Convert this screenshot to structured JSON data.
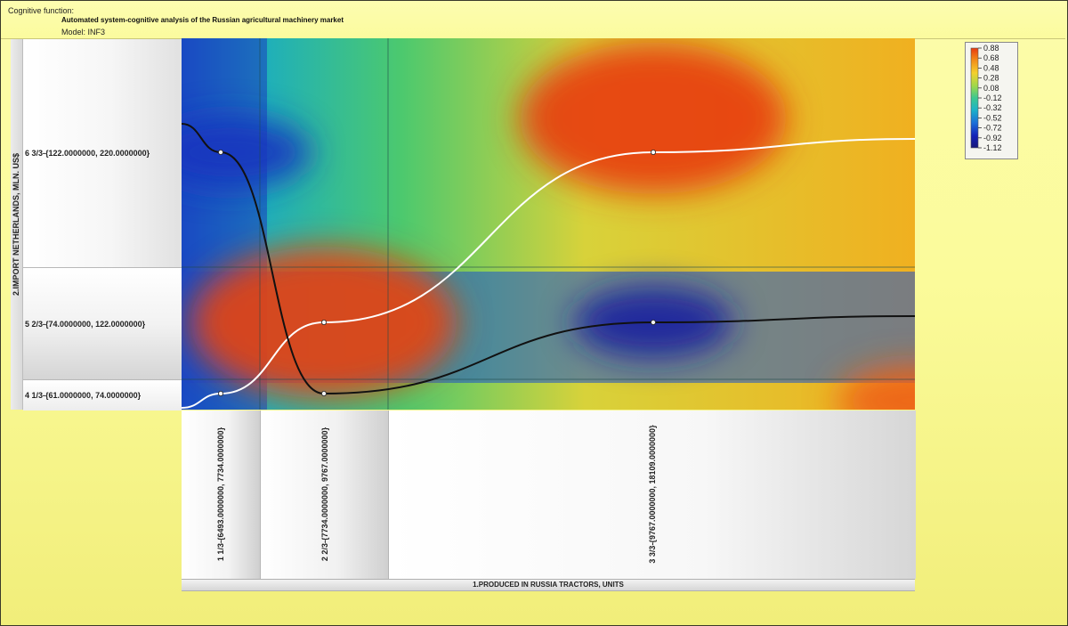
{
  "header": {
    "label": "Cognitive function:",
    "title": "Automated system-cognitive analysis of the Russian agricultural machinery market",
    "model": "Model: INF3"
  },
  "chart_data": {
    "type": "heatmap",
    "title": "Automated system-cognitive analysis of the Russian agricultural machinery market",
    "xlabel": "1.PRODUCED IN RUSSIA TRACTORS, UNITS",
    "ylabel": "2.IMPORT NETHERLANDS, MLN. US$",
    "x_categories": [
      "1 1/3-{6493.0000000, 7734.0000000}",
      "2 2/3-{7734.0000000, 9767.0000000}",
      "3 3/3-{9767.0000000, 18109.0000000}"
    ],
    "x_bins": [
      [
        6493,
        7734
      ],
      [
        7734,
        9767
      ],
      [
        9767,
        18109
      ]
    ],
    "y_categories": [
      "6 3/3-{122.0000000, 220.0000000}",
      "5 2/3-{74.0000000, 122.0000000}",
      "4 1/3-{61.0000000, 74.0000000}"
    ],
    "y_bins": [
      [
        122,
        220
      ],
      [
        74,
        122
      ],
      [
        61,
        74
      ]
    ],
    "colorbar": {
      "ticks": [
        "0.88",
        "0.68",
        "0.48",
        "0.28",
        "0.08",
        "-0.12",
        "-0.32",
        "-0.52",
        "-0.72",
        "-0.92",
        "-1.12"
      ],
      "range": [
        -1.12,
        0.88
      ]
    },
    "series": [
      {
        "style": "white-line",
        "points": [
          {
            "x": 0,
            "y": 2
          },
          {
            "x": 1,
            "y": 1
          },
          {
            "x": 2,
            "y": 0
          }
        ]
      },
      {
        "style": "black-line",
        "points": [
          {
            "x": 0,
            "y": 0
          },
          {
            "x": 1,
            "y": 2
          },
          {
            "x": 2,
            "y": 1
          }
        ]
      }
    ],
    "hotspots": [
      {
        "x": 2.0,
        "y": -0.2,
        "value": 0.88
      },
      {
        "x": 1.0,
        "y": 1.0,
        "value": 0.85
      },
      {
        "x": 2.8,
        "y": 2.1,
        "value": 0.75
      },
      {
        "x": 2.0,
        "y": 1.0,
        "value": -1.0
      },
      {
        "x": 0.1,
        "y": 0.0,
        "value": -0.85
      }
    ]
  }
}
